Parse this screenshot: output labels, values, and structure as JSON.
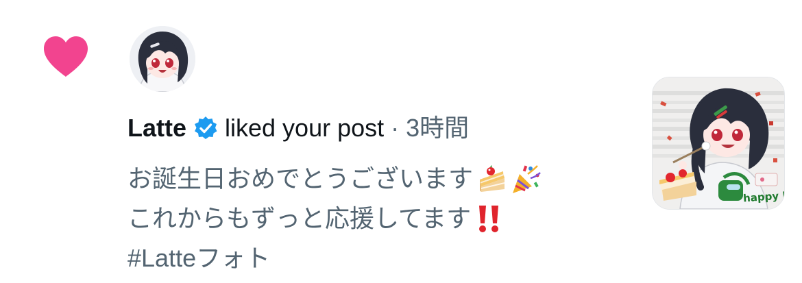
{
  "notification": {
    "type": "like",
    "icon": "heart-icon",
    "accent_color": "#f2448f",
    "user_name": "Latte",
    "verified": true,
    "verified_color": "#1d9bf0",
    "action_text": "liked your post",
    "separator": "·",
    "time": "3時間",
    "post_lines": [
      "お誕生日おめでとうございます",
      "これからもずっと応援してます"
    ],
    "post_emojis_line1": [
      "shortcake-emoji",
      "party-popper-emoji"
    ],
    "post_emojis_line2": [
      "double-exclamation-emoji"
    ],
    "hashtag": "#Latteフォト",
    "thumbnail_caption": "happy Birthday"
  }
}
